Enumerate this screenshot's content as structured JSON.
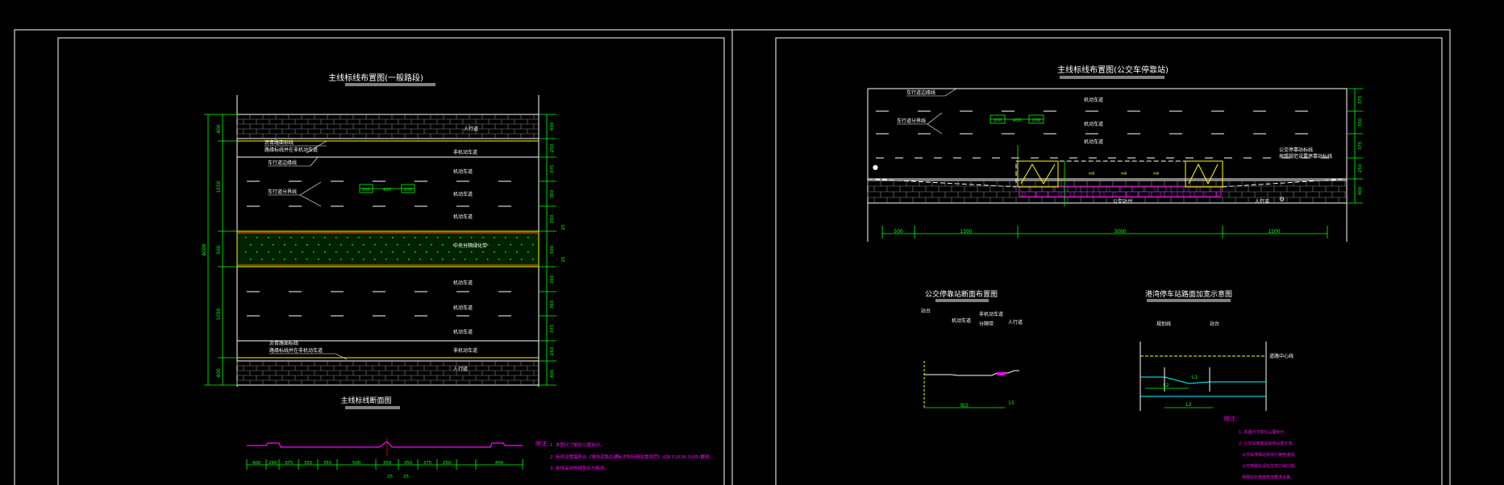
{
  "colors": {
    "background": "#000000",
    "frame": "#ffffff",
    "dimension": "#00ff00",
    "annotation": "#ffffff",
    "marking_yellow": "#ffff00",
    "median_fill": "#003300",
    "curb_magenta": "#ff00ff",
    "water": "#00ffff",
    "notes": "#ff00ff"
  },
  "left_sheet": {
    "plan_title": "主线标线布置图(一般路段)",
    "section_title": "主线标线断面图",
    "labels": {
      "sidewalk_top": "人行道",
      "sidewalk_bottom": "人行道",
      "nonmotor_top": "非机动车道",
      "nonmotor_bottom": "非机动车道",
      "lane": "机动车道",
      "median": "中央分隔绿化带",
      "edge_line_top": "沥青路面标线",
      "edge_line_top2": "路缘标线并在非机动车道",
      "guide_top": "车行道边缘线",
      "guide_mid": "车行道分界线",
      "edge_line_bottom": "沥青路面标线",
      "edge_line_bottom2": "路缘标线并在非机动车道"
    },
    "right_dims": [
      "400",
      "250",
      "375",
      "350",
      "350",
      "25",
      "500",
      "25",
      "350",
      "350",
      "375",
      "250",
      "400"
    ],
    "left_dims": [
      "400",
      "1050",
      "500",
      "1050",
      "400"
    ],
    "total_dim": "4000",
    "dash_dims": [
      "200",
      "400",
      "200"
    ],
    "section_dims": [
      "400",
      "250",
      "375",
      "350",
      "350",
      "500",
      "350",
      "350",
      "375",
      "250",
      "400"
    ],
    "section_sub": [
      "25",
      "25"
    ],
    "notes_title": "附注:",
    "notes": [
      "1. 本图尺寸单位以厘米计。",
      "2. 标线设置需符合《城市道路交通标志和标线设置规范》(GB 51038-2015)要求。",
      "3. 标线采用热熔型反光标线。"
    ]
  },
  "right_sheet": {
    "plan_title": "主线标线布置图(公交车停靠站)",
    "labels": {
      "lane_a": "机动车道",
      "lane_b": "机动车道",
      "lane_c": "机动车道",
      "lane_d": "非机动车道",
      "edge": "车行道边缘线",
      "divider": "车行道分界线",
      "bus_text": "公交车停靠站",
      "bus_note": "公交停靠站标线",
      "bus_note2": "按照规范设置停靠站标线",
      "bus_sign": "公交站台",
      "sidewalk": "人行道"
    },
    "dash_dims": [
      "200",
      "400",
      "200"
    ],
    "bottom_dims": [
      "500",
      "1500",
      "3000",
      "1500"
    ],
    "right_dims": [
      "375",
      "350",
      "375",
      "250",
      "400"
    ],
    "section_title": "公交停靠站断面布置图",
    "section_labels": [
      "站台",
      "机动车道",
      "非机动车道",
      "人行道",
      "分隔带"
    ],
    "section_dims": [
      "B/2",
      "15"
    ],
    "drain_title": "港湾停车站路面加宽示意图",
    "drain_labels": [
      "规划线",
      "站台",
      "道路中心线"
    ],
    "drain_dims": [
      "L2",
      "L1",
      "L2"
    ],
    "notes_title": "附注:",
    "notes": [
      "1. 本图尺寸单位以厘米计。",
      "2. 公交车停靠站标线设置示意。",
      "公交车停靠站标线为黄色虚线。",
      "公交停靠站设在交叉口出口道。",
      "停靠站长度按规范要求设置。"
    ]
  }
}
